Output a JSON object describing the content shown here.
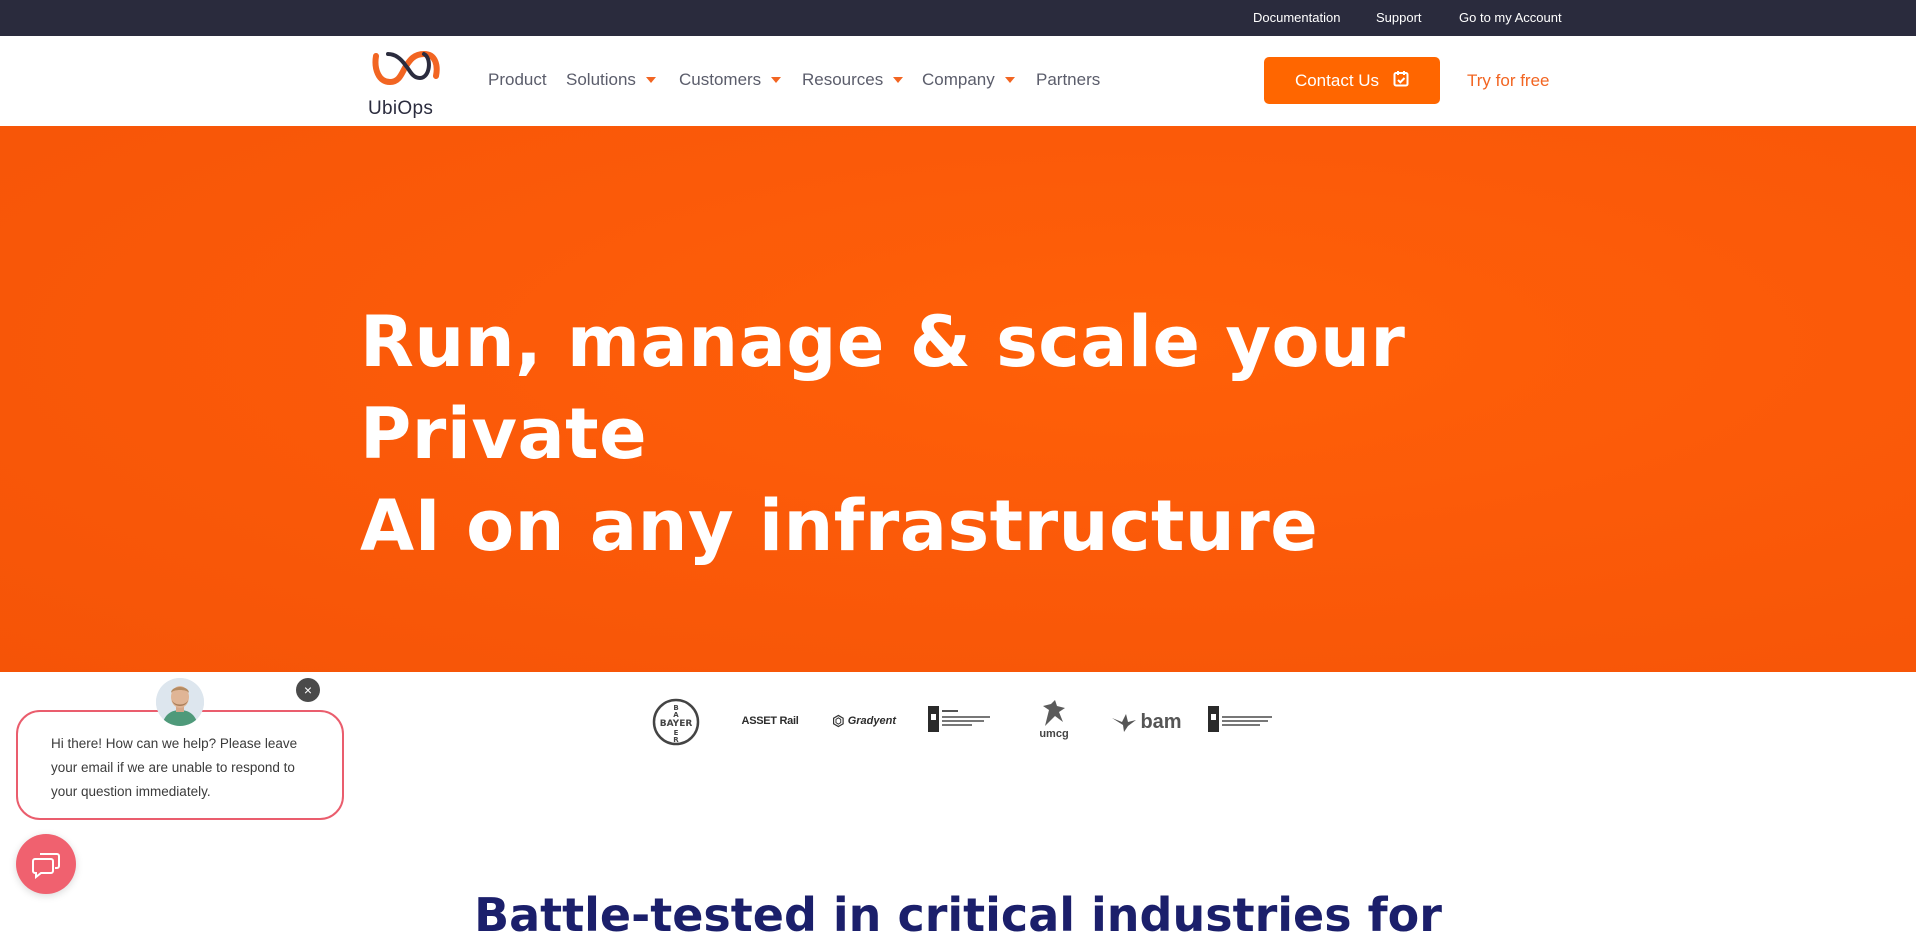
{
  "topbar": {
    "links": [
      "Documentation",
      "Support",
      "Go to my Account"
    ]
  },
  "brand": {
    "name": "UbiOps"
  },
  "nav": {
    "items": [
      {
        "label": "Product"
      },
      {
        "label": "Solutions"
      },
      {
        "label": "Customers"
      },
      {
        "label": "Resources"
      },
      {
        "label": "Company"
      },
      {
        "label": "Partners"
      }
    ],
    "contact_label": "Contact Us",
    "try_label": "Try for free"
  },
  "hero": {
    "line1": "Run, manage & scale your Private",
    "line2": "AI on any infrastructure"
  },
  "customers": {
    "logos": [
      {
        "name": "bayer-logo",
        "text": "BAYER"
      },
      {
        "name": "asset-rail-logo",
        "text": "ASSET Rail"
      },
      {
        "name": "gradyent-logo",
        "text": "Gradyent"
      },
      {
        "name": "ministry-logo-1",
        "text": ""
      },
      {
        "name": "umcg-logo",
        "text": "umcg"
      },
      {
        "name": "bam-logo",
        "text": "bam"
      },
      {
        "name": "ministry-logo-2",
        "text": ""
      }
    ]
  },
  "section": {
    "heading": "Battle-tested in critical industries for"
  },
  "chat": {
    "message": "Hi there! How can we help? Please leave your email if we are unable to respond to your question immediately.",
    "close_symbol": "×"
  },
  "colors": {
    "accent": "#ff6600",
    "hero_bg": "#fb5a09",
    "topbar_bg": "#2a2b3d",
    "chat_accent": "#ea5d6d",
    "heading_navy": "#1b1f6b"
  }
}
